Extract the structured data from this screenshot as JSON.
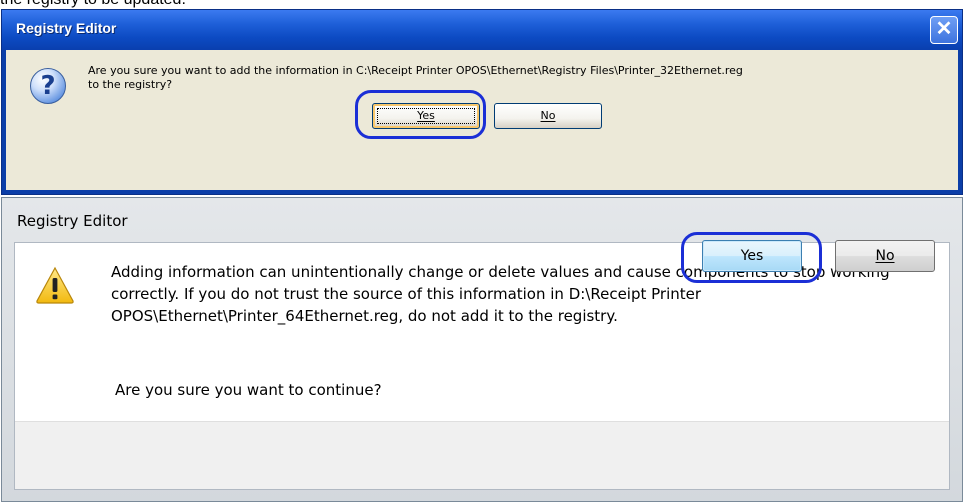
{
  "background_caption_clipped": "the registry to be updated.",
  "dialog_xp": {
    "title": "Registry Editor",
    "close_glyph": "✕",
    "icon": "question-icon",
    "message_line1": "Are you sure you want to add the information in C:\\Receipt Printer OPOS\\Ethernet\\Registry Files\\Printer_32Ethernet.reg",
    "message_line2": "to the registry?",
    "yes_label": "Yes",
    "no_label": "No",
    "accent": "#0b3ea8",
    "highlight": "#1b2fd6"
  },
  "dialog_win7": {
    "title": "Registry Editor",
    "icon": "warning-icon",
    "message": "Adding information can unintentionally change or delete values and cause components to stop working correctly. If you do not trust the source of this information in D:\\Receipt Printer OPOS\\Ethernet\\Printer_64Ethernet.reg, do not add it to the registry.",
    "question": "Are you sure you want to continue?",
    "yes_label": "Yes",
    "no_label": "No",
    "highlight": "#1b2fd6"
  }
}
